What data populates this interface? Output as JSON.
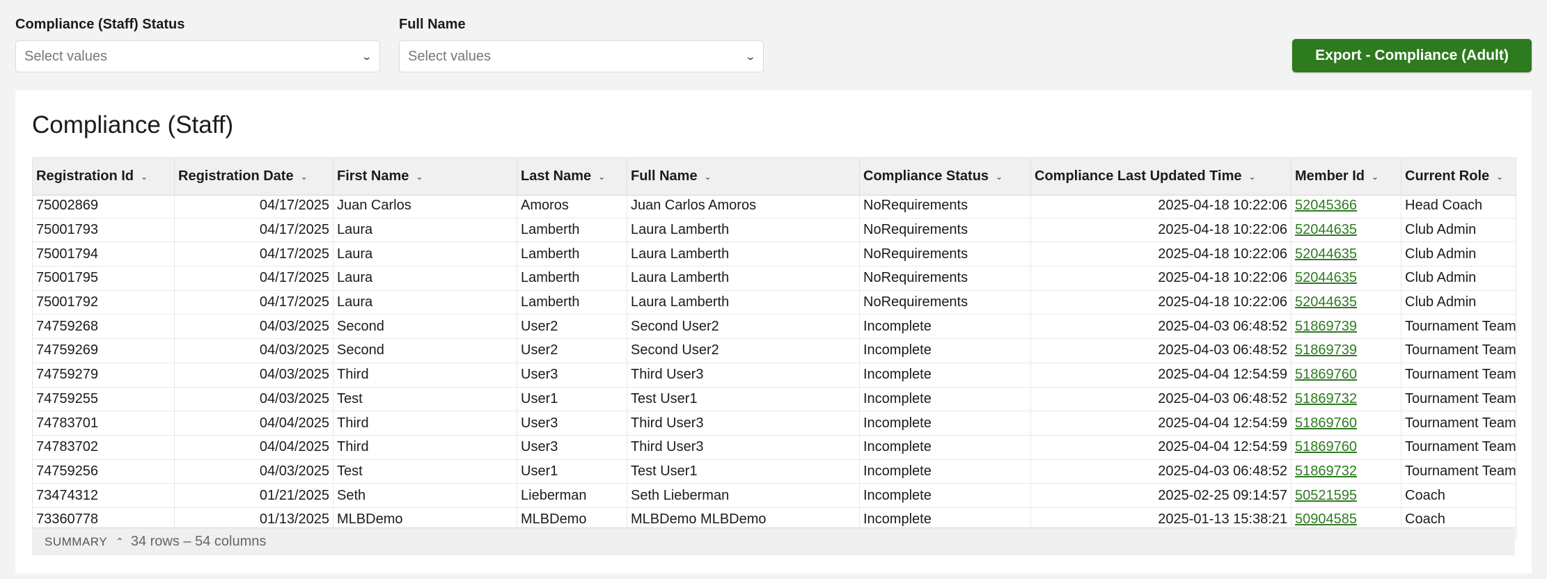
{
  "filters": {
    "status": {
      "label": "Compliance (Staff) Status",
      "placeholder": "Select values"
    },
    "full_name": {
      "label": "Full Name",
      "placeholder": "Select values"
    }
  },
  "export_button": "Export - Compliance (Adult)",
  "card_title": "Compliance (Staff)",
  "columns": [
    "Registration Id",
    "Registration Date",
    "First Name",
    "Last Name",
    "Full Name",
    "Compliance Status",
    "Compliance Last Updated Time",
    "Member Id",
    "Current Role"
  ],
  "rows": [
    [
      "75002869",
      "04/17/2025",
      "Juan Carlos",
      "Amoros",
      "Juan Carlos Amoros",
      "NoRequirements",
      "2025-04-18 10:22:06",
      "52045366",
      "Head Coach"
    ],
    [
      "75001793",
      "04/17/2025",
      "Laura",
      "Lamberth",
      "Laura Lamberth",
      "NoRequirements",
      "2025-04-18 10:22:06",
      "52044635",
      "Club Admin"
    ],
    [
      "75001794",
      "04/17/2025",
      "Laura",
      "Lamberth",
      "Laura Lamberth",
      "NoRequirements",
      "2025-04-18 10:22:06",
      "52044635",
      "Club Admin"
    ],
    [
      "75001795",
      "04/17/2025",
      "Laura",
      "Lamberth",
      "Laura Lamberth",
      "NoRequirements",
      "2025-04-18 10:22:06",
      "52044635",
      "Club Admin"
    ],
    [
      "75001792",
      "04/17/2025",
      "Laura",
      "Lamberth",
      "Laura Lamberth",
      "NoRequirements",
      "2025-04-18 10:22:06",
      "52044635",
      "Club Admin"
    ],
    [
      "74759268",
      "04/03/2025",
      "Second",
      "User2",
      "Second User2",
      "Incomplete",
      "2025-04-03 06:48:52",
      "51869739",
      "Tournament Team"
    ],
    [
      "74759269",
      "04/03/2025",
      "Second",
      "User2",
      "Second User2",
      "Incomplete",
      "2025-04-03 06:48:52",
      "51869739",
      "Tournament Team"
    ],
    [
      "74759279",
      "04/03/2025",
      "Third",
      "User3",
      "Third User3",
      "Incomplete",
      "2025-04-04 12:54:59",
      "51869760",
      "Tournament Team"
    ],
    [
      "74759255",
      "04/03/2025",
      "Test",
      "User1",
      "Test User1",
      "Incomplete",
      "2025-04-03 06:48:52",
      "51869732",
      "Tournament Team"
    ],
    [
      "74783701",
      "04/04/2025",
      "Third",
      "User3",
      "Third User3",
      "Incomplete",
      "2025-04-04 12:54:59",
      "51869760",
      "Tournament Team"
    ],
    [
      "74783702",
      "04/04/2025",
      "Third",
      "User3",
      "Third User3",
      "Incomplete",
      "2025-04-04 12:54:59",
      "51869760",
      "Tournament Team"
    ],
    [
      "74759256",
      "04/03/2025",
      "Test",
      "User1",
      "Test User1",
      "Incomplete",
      "2025-04-03 06:48:52",
      "51869732",
      "Tournament Team"
    ],
    [
      "73474312",
      "01/21/2025",
      "Seth",
      "Lieberman",
      "Seth Lieberman",
      "Incomplete",
      "2025-02-25 09:14:57",
      "50521595",
      "Coach"
    ],
    [
      "73360778",
      "01/13/2025",
      "MLBDemo",
      "MLBDemo",
      "MLBDemo MLBDemo",
      "Incomplete",
      "2025-01-13 15:38:21",
      "50904585",
      "Coach"
    ]
  ],
  "summary": {
    "label": "SUMMARY",
    "info": "34 rows – 54 columns"
  },
  "colors": {
    "accent": "#2e7a1f",
    "link": "#2f7a22"
  },
  "icons": {
    "select_chevron": "chevron-down-icon",
    "header_caret": "caret-down-icon",
    "summary_toggle": "chevron-up-icon"
  }
}
